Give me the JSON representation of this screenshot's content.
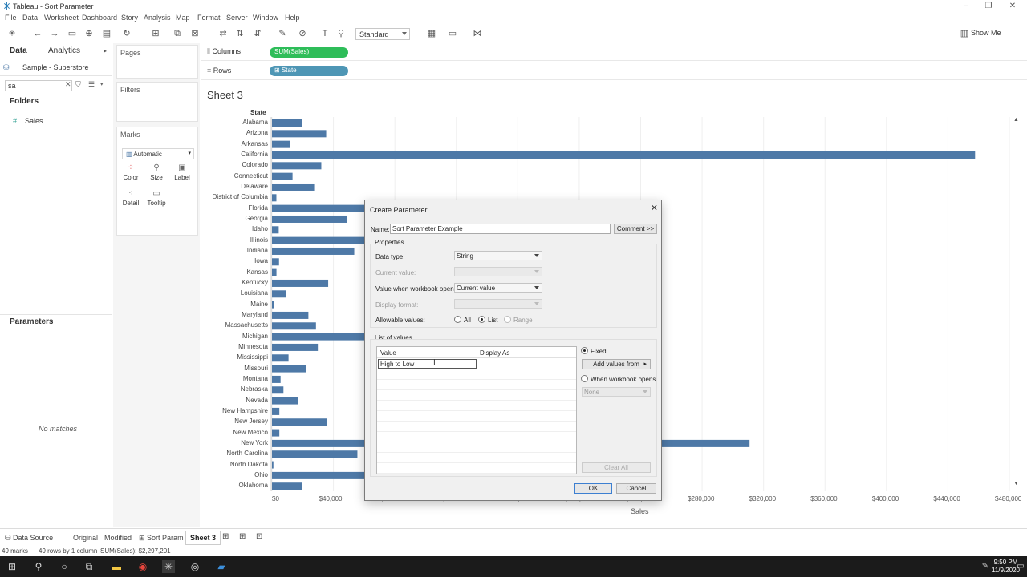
{
  "window": {
    "title": "Tableau - Sort Parameter"
  },
  "menu": [
    "File",
    "Data",
    "Worksheet",
    "Dashboard",
    "Story",
    "Analysis",
    "Map",
    "Format",
    "Server",
    "Window",
    "Help"
  ],
  "toolbar": {
    "fit_select": "Standard",
    "show_me": "Show Me"
  },
  "left_pane": {
    "tab_data": "Data",
    "tab_analytics": "Analytics",
    "datasource": "Sample - Superstore",
    "search_value": "sa",
    "folders_title": "Folders",
    "field": "Sales",
    "parameters_title": "Parameters",
    "no_matches": "No matches"
  },
  "cards": {
    "pages": "Pages",
    "filters": "Filters",
    "marks": "Marks",
    "marks_type": "Automatic",
    "buttons": [
      "Color",
      "Size",
      "Label",
      "Detail",
      "Tooltip"
    ]
  },
  "shelves": {
    "columns_label": "Columns",
    "rows_label": "Rows",
    "columns_pill": "SUM(Sales)",
    "rows_pill": "State"
  },
  "sheet": {
    "title": "Sheet 3",
    "dimension_header": "State",
    "x_axis_title": "Sales"
  },
  "chart_data": {
    "type": "bar",
    "orientation": "horizontal",
    "categories": [
      "Alabama",
      "Arizona",
      "Arkansas",
      "California",
      "Colorado",
      "Connecticut",
      "Delaware",
      "District of Columbia",
      "Florida",
      "Georgia",
      "Idaho",
      "Illinois",
      "Indiana",
      "Iowa",
      "Kansas",
      "Kentucky",
      "Louisiana",
      "Maine",
      "Maryland",
      "Massachusetts",
      "Michigan",
      "Minnesota",
      "Mississippi",
      "Missouri",
      "Montana",
      "Nebraska",
      "Nevada",
      "New Hampshire",
      "New Jersey",
      "New Mexico",
      "New York",
      "North Carolina",
      "North Dakota",
      "Ohio",
      "Oklahoma"
    ],
    "values": [
      19511,
      35282,
      11678,
      457688,
      32108,
      13384,
      27451,
      2865,
      89474,
      49096,
      4382,
      80166,
      53555,
      4580,
      2914,
      36592,
      9217,
      1271,
      23706,
      28634,
      76270,
      29863,
      10771,
      22205,
      5589,
      7465,
      16729,
      4793,
      35764,
      4784,
      310876,
      55603,
      920,
      78258,
      19683
    ],
    "xlabel": "Sales",
    "xlim": [
      0,
      480000
    ],
    "x_ticks": [
      "$0",
      "$40,000",
      "$80,000",
      "$120,000",
      "$160,000",
      "$200,000",
      "$240,000",
      "$280,000",
      "$320,000",
      "$360,000",
      "$400,000",
      "$440,000",
      "$480,000"
    ],
    "bar_color": "#4e79a7",
    "grid": true
  },
  "dialog": {
    "title": "Create Parameter",
    "name_label": "Name:",
    "name_value": "Sort Parameter Example",
    "comment_button": "Comment >>",
    "properties_label": "Properties",
    "data_type_label": "Data type:",
    "data_type_value": "String",
    "current_value_label": "Current value:",
    "workbook_opens_label": "Value when workbook opens:",
    "workbook_opens_value": "Current value",
    "display_format_label": "Display format:",
    "allowable_label": "Allowable values:",
    "allow_all": "All",
    "allow_list": "List",
    "allow_range": "Range",
    "list_label": "List of values",
    "col_value": "Value",
    "col_display": "Display As",
    "edit_value": "High to Low",
    "fixed_label": "Fixed",
    "add_values_button": "Add values from",
    "when_opens_label": "When workbook opens",
    "when_opens_select": "None",
    "clear_all_button": "Clear All",
    "ok_button": "OK",
    "cancel_button": "Cancel"
  },
  "tabs": [
    "Data Source",
    "Original",
    "Modified",
    "Sort Param",
    "Sheet 3"
  ],
  "status": {
    "marks": "49 marks",
    "rows": "49 rows by 1 column",
    "sum": "SUM(Sales): $2,297,201"
  },
  "clock": {
    "time": "9:50 PM",
    "date": "11/9/2020"
  }
}
